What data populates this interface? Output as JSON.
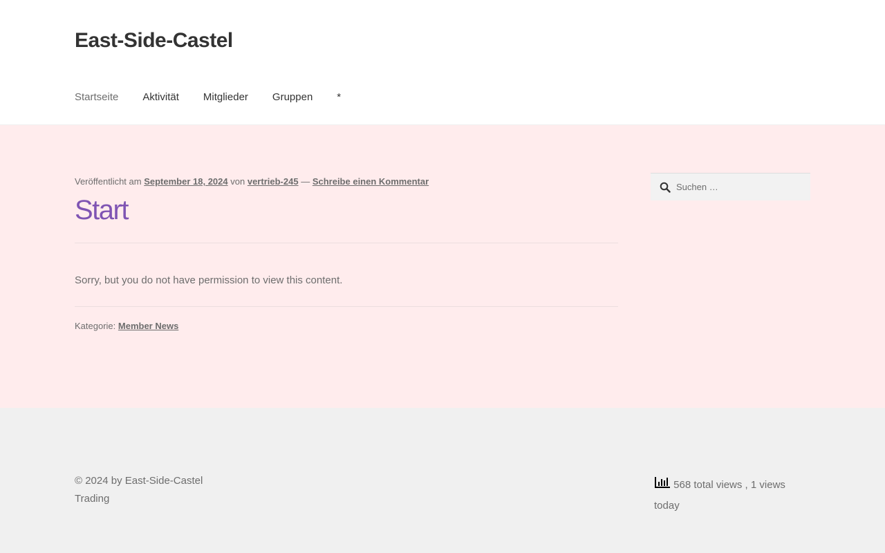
{
  "header": {
    "site_title": "East-Side-Castel",
    "nav": [
      {
        "label": "Startseite",
        "current": true
      },
      {
        "label": "Aktivität",
        "current": false
      },
      {
        "label": "Mitglieder",
        "current": false
      },
      {
        "label": "Gruppen",
        "current": false
      },
      {
        "label": "*",
        "current": false
      }
    ]
  },
  "post": {
    "meta": {
      "published_prefix": "Veröffentlicht am",
      "date": "September 18, 2024",
      "by_word": "von",
      "author": "vertrieb-245",
      "dash": "—",
      "comment_link": "Schreibe einen Kommentar"
    },
    "title": "Start",
    "body": "Sorry, but you do not have permission to view this content.",
    "category_label": "Kategorie:",
    "category": "Member News"
  },
  "sidebar": {
    "search_placeholder": "Suchen …",
    "search_icon": "search-icon"
  },
  "footer": {
    "copyright": "© 2024 by East-Side-Castel Trading",
    "stats_icon": "bar-chart-icon",
    "stats_text": "568 total views , 1 views today"
  },
  "colors": {
    "title_accent": "#7f54b3",
    "content_bg": "#ffeced",
    "footer_bg": "#f0f0f0",
    "text": "#6d6d6d",
    "heading": "#333333"
  }
}
